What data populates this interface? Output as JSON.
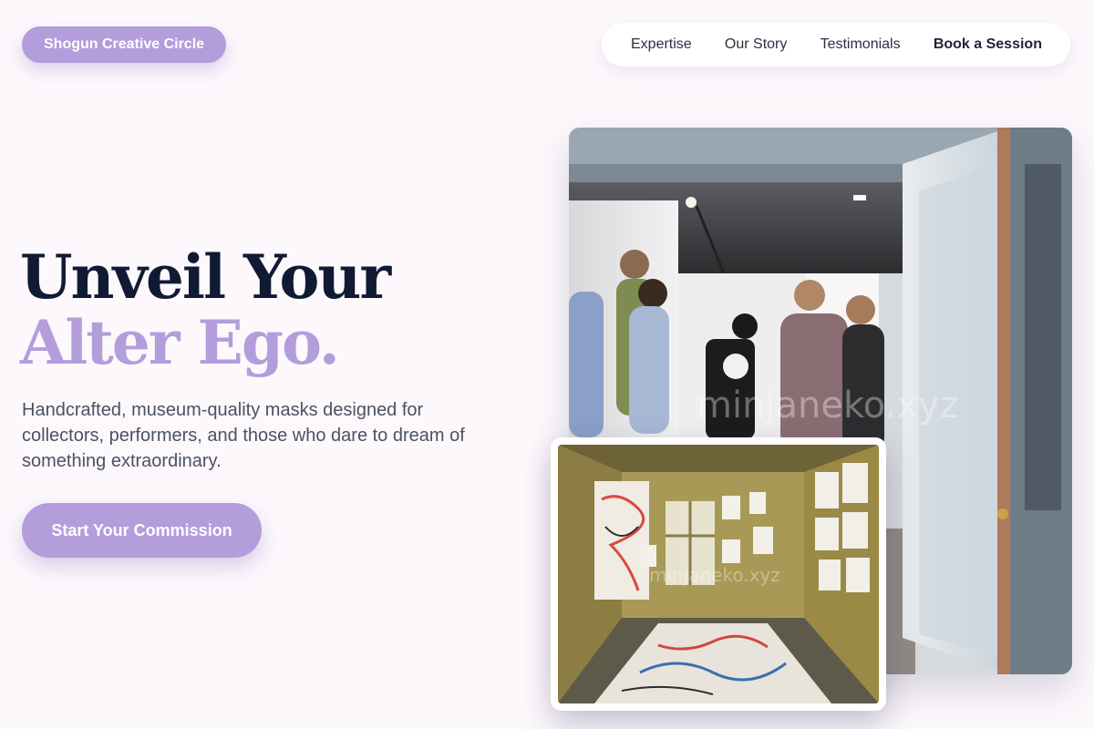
{
  "brand": {
    "label": "Shogun Creative Circle"
  },
  "nav": {
    "items": [
      "Expertise",
      "Our Story",
      "Testimonials"
    ],
    "cta": "Book a Session"
  },
  "hero": {
    "headline_line1": "Unveil Your",
    "headline_line2": "Alter Ego.",
    "subcopy": "Handcrafted, museum-quality masks designed for collectors, performers, and those who dare to dream of something extraordinary.",
    "button": "Start Your Commission"
  },
  "images": {
    "main": {
      "alt": "people-in-gallery-photo",
      "watermark": "minjaneko.xyz"
    },
    "secondary": {
      "alt": "artist-studio-photo",
      "watermark": "minjaneko.xyz"
    }
  },
  "colors": {
    "accent": "#b39ddb",
    "heading": "#111a33",
    "background": "#fcf8fc"
  }
}
